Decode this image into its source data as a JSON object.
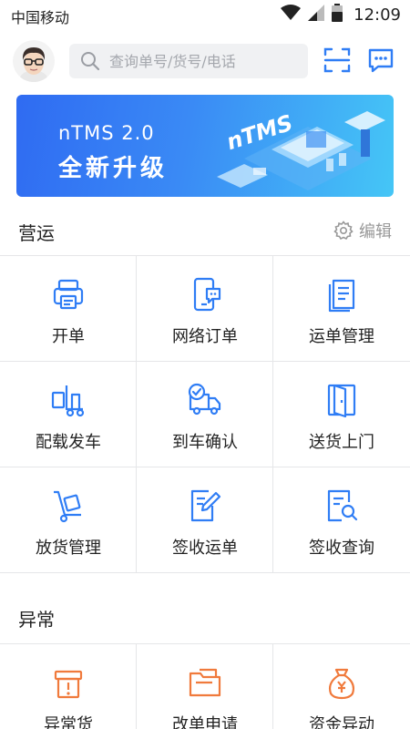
{
  "status_bar": {
    "carrier": "中国移动",
    "time": "12:09"
  },
  "search": {
    "placeholder": "查询单号/货号/电话"
  },
  "banner": {
    "title": "nTMS 2.0",
    "subtitle": "全新升级",
    "art_label": "nTMS"
  },
  "operations": {
    "title": "营运",
    "edit_label": "编辑",
    "items": [
      {
        "label": "开单",
        "icon": "printer-icon"
      },
      {
        "label": "网络订单",
        "icon": "phone-chat-icon"
      },
      {
        "label": "运单管理",
        "icon": "document-icon"
      },
      {
        "label": "配载发车",
        "icon": "forklift-icon"
      },
      {
        "label": "到车确认",
        "icon": "truck-check-icon"
      },
      {
        "label": "送货上门",
        "icon": "door-icon"
      },
      {
        "label": "放货管理",
        "icon": "hand-cart-icon"
      },
      {
        "label": "签收运单",
        "icon": "sign-pen-icon"
      },
      {
        "label": "签收查询",
        "icon": "doc-search-icon"
      }
    ]
  },
  "exceptions": {
    "title": "异常",
    "items": [
      {
        "label": "异常货",
        "icon": "warning-box-icon"
      },
      {
        "label": "改单申请",
        "icon": "folder-edit-icon"
      },
      {
        "label": "资金异动",
        "icon": "money-bag-icon"
      }
    ]
  },
  "colors": {
    "primary": "#2f7df5",
    "orange": "#f07a3c",
    "divider": "#e5e6e8"
  }
}
